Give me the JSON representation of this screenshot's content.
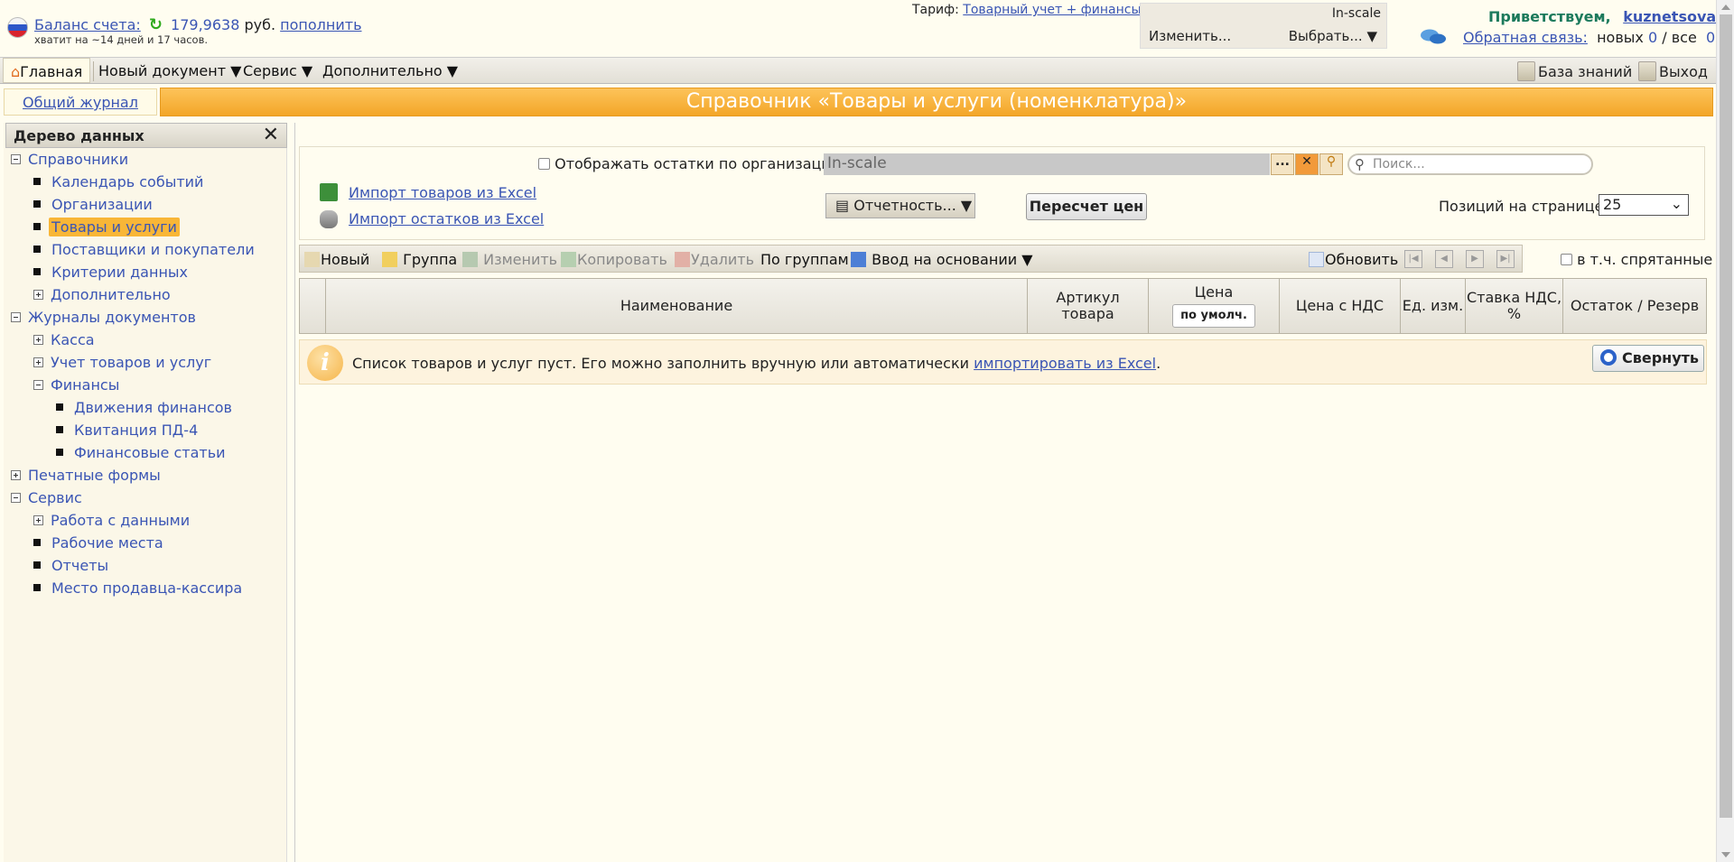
{
  "header": {
    "balance_label": "Баланс счета:",
    "balance_amount": "179,9638",
    "currency": "руб.",
    "top_up": "пополнить",
    "enough_for": "хватит на ~14 дней и 17 часов.",
    "tariff_label": "Тариф:",
    "tariff_value": "Товарный учет + финансы",
    "org_name": "In-scale",
    "org_change": "Изменить...",
    "org_select": "Выбрать...",
    "greeting": "Приветствуем,",
    "username": "kuznetsova",
    "feedback_label": "Обратная связь:",
    "new_label": "новых",
    "new_count": "0",
    "all_label": "/ все",
    "all_count": "0"
  },
  "menu": {
    "home": "Главная",
    "new_doc": "Новый документ ▼",
    "service": "Сервис ▼",
    "extra": "Дополнительно ▼",
    "knowledge": "База знаний",
    "logout": "Выход"
  },
  "title_row": {
    "journal_tab": "Общий журнал",
    "page_title": "Справочник «Товары и услуги (номенклатура)»"
  },
  "sidebar": {
    "title": "Дерево данных",
    "close": "✕",
    "items": [
      {
        "label": "Справочники",
        "level": 0,
        "type": "minus"
      },
      {
        "label": "Календарь событий",
        "level": 1,
        "type": "leaf"
      },
      {
        "label": "Организации",
        "level": 1,
        "type": "leaf"
      },
      {
        "label": "Товары и услуги",
        "level": 1,
        "type": "leaf",
        "selected": true
      },
      {
        "label": "Поставщики и покупатели",
        "level": 1,
        "type": "leaf"
      },
      {
        "label": "Критерии данных",
        "level": 1,
        "type": "leaf"
      },
      {
        "label": "Дополнительно",
        "level": 1,
        "type": "plus"
      },
      {
        "label": "Журналы документов",
        "level": 0,
        "type": "minus"
      },
      {
        "label": "Касса",
        "level": 1,
        "type": "plus"
      },
      {
        "label": "Учет товаров и услуг",
        "level": 1,
        "type": "plus"
      },
      {
        "label": "Финансы",
        "level": 1,
        "type": "minus"
      },
      {
        "label": "Движения финансов",
        "level": 2,
        "type": "leaf"
      },
      {
        "label": "Квитанция ПД-4",
        "level": 2,
        "type": "leaf"
      },
      {
        "label": "Финансовые статьи",
        "level": 2,
        "type": "leaf"
      },
      {
        "label": "Печатные формы",
        "level": 0,
        "type": "plus"
      },
      {
        "label": "Сервис",
        "level": 0,
        "type": "minus"
      },
      {
        "label": "Работа с данными",
        "level": 1,
        "type": "plus"
      },
      {
        "label": "Рабочие места",
        "level": 1,
        "type": "leaf"
      },
      {
        "label": "Отчеты",
        "level": 1,
        "type": "leaf"
      },
      {
        "label": "Место продавца-кассира",
        "level": 1,
        "type": "leaf"
      }
    ]
  },
  "filters": {
    "org_balance_label": "Отображать остатки по организации",
    "org_value": "In-scale",
    "dots": "...",
    "search_placeholder": "Поиск...",
    "import_goods": "Импорт товаров из Excel",
    "import_stock": "Импорт остатков из Excel",
    "reports": "Отчетность... ▼",
    "recalc": "Пересчет цен",
    "per_page_label": "Позиций на странице",
    "per_page_value": "25"
  },
  "toolbar": {
    "new": "Новый",
    "group": "Группа",
    "edit": "Изменить",
    "copy": "Копировать",
    "delete": "Удалить",
    "by_groups": "По группам",
    "based_on": "Ввод на основании ▼",
    "refresh": "Обновить",
    "include_hidden": "в т.ч. спрятанные"
  },
  "table": {
    "columns": [
      {
        "label": ""
      },
      {
        "label": "Наименование"
      },
      {
        "label": "Артикул товара"
      },
      {
        "label": "Цена",
        "sub": "по умолч."
      },
      {
        "label": "Цена с НДС"
      },
      {
        "label": "Ед. изм."
      },
      {
        "label": "Ставка НДС, %"
      },
      {
        "label": "Остаток / Резерв"
      }
    ]
  },
  "notice": {
    "text": "Список товаров и услуг пуст. Его можно заполнить вручную или автоматически",
    "link": "импортировать из Excel",
    "end": ".",
    "collapse": "Свернуть"
  }
}
